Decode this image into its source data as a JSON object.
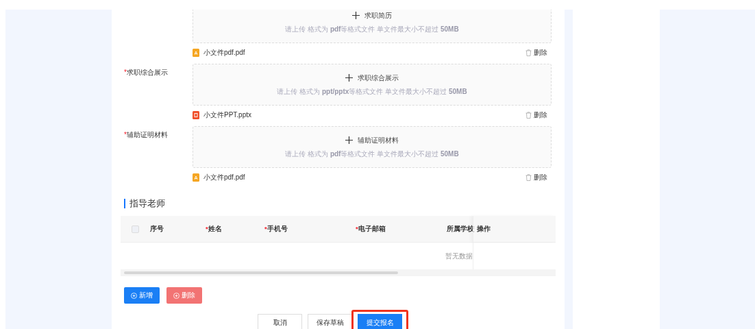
{
  "uploads": [
    {
      "button": "求职简历",
      "hint": "请上传 格式为 **pdf**等格式文件 单文件最大小不超过 **50MB**",
      "file": {
        "kind": "pdf",
        "name": "小文件pdf.pdf",
        "action": "删除"
      }
    },
    {
      "label": "求职综合展示",
      "required_mark": "*",
      "button": "求职综合展示",
      "hint": "请上传 格式为 **ppt/pptx**等格式文件 单文件最大小不超过 **50MB**",
      "file": {
        "kind": "ppt",
        "name": "小文件PPT.pptx",
        "action": "删除"
      }
    },
    {
      "label": "辅助证明材料",
      "required_mark": "*",
      "button": "辅助证明材料",
      "hint": "请上传 格式为 **pdf**等格式文件 单文件最大小不超过 **50MB**",
      "file": {
        "kind": "pdf",
        "name": "小文件pdf.pdf",
        "action": "删除"
      }
    }
  ],
  "section_title": "指导老师",
  "table": {
    "select_all": {
      "checked": false
    },
    "columns": [
      {
        "label": "序号"
      },
      {
        "label": "姓名",
        "required_mark": "*"
      },
      {
        "label": "手机号",
        "required_mark": "*"
      },
      {
        "label": "电子邮箱",
        "required_mark": "*"
      },
      {
        "label": "所属学校"
      },
      {
        "label": "操作"
      }
    ],
    "empty_text": "暂无数据"
  },
  "table_buttons": [
    {
      "kind": "add",
      "label": "新增"
    },
    {
      "kind": "delete",
      "label": "删除"
    }
  ],
  "footer_buttons": [
    {
      "kind": "default",
      "label": "取消",
      "highlighted": false
    },
    {
      "kind": "default",
      "label": "保存草稿",
      "highlighted": false
    },
    {
      "kind": "primary",
      "label": "提交报名",
      "highlighted": true
    }
  ]
}
